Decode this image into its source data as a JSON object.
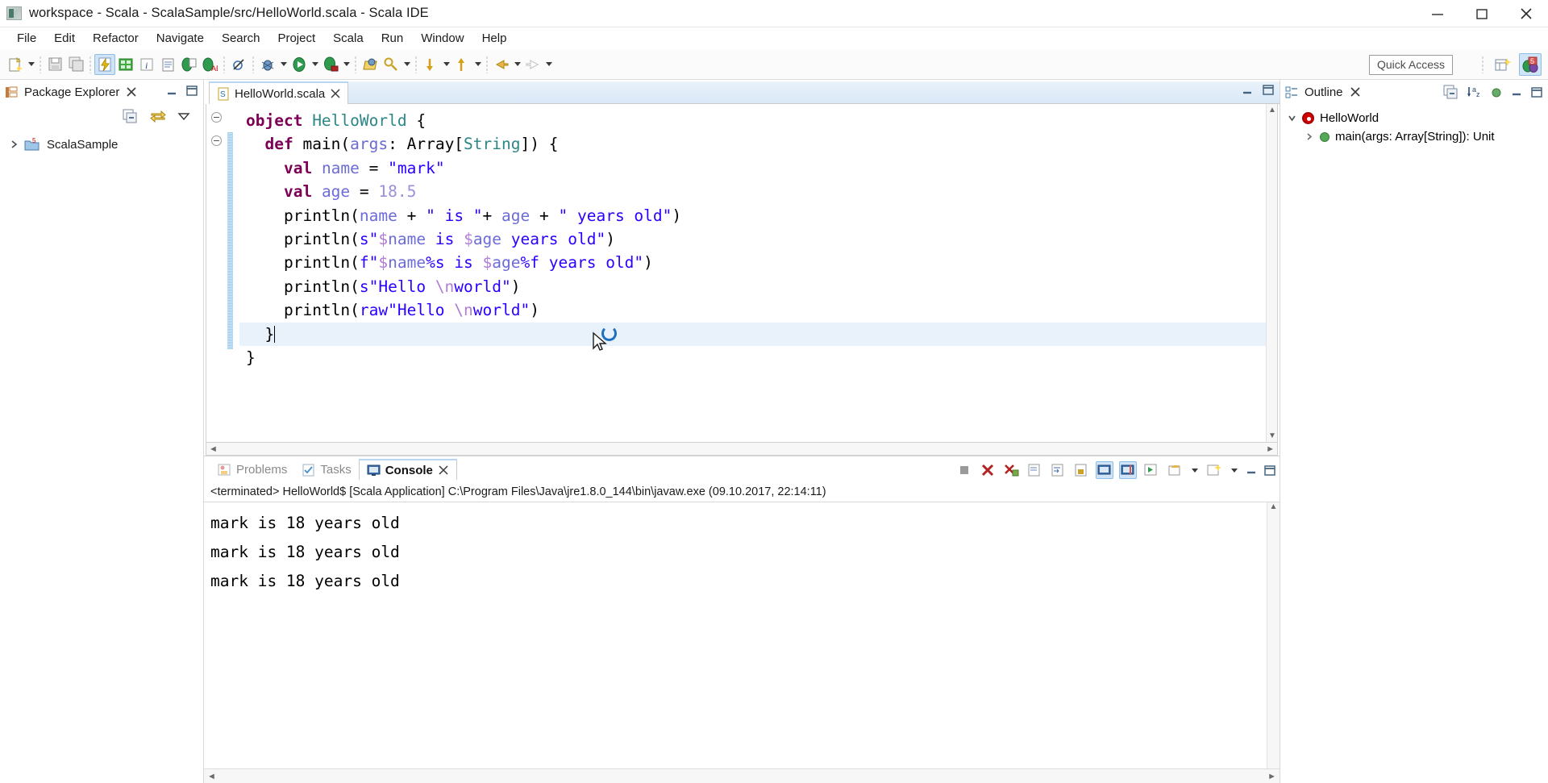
{
  "window": {
    "title": "workspace - Scala - ScalaSample/src/HelloWorld.scala - Scala IDE",
    "app_icon": "scala-ide-icon",
    "minimize_label": "minimize-icon",
    "maximize_label": "maximize-icon",
    "close_label": "close-icon"
  },
  "menubar": {
    "items": [
      {
        "label": "File"
      },
      {
        "label": "Edit"
      },
      {
        "label": "Refactor"
      },
      {
        "label": "Navigate"
      },
      {
        "label": "Search"
      },
      {
        "label": "Project"
      },
      {
        "label": "Scala"
      },
      {
        "label": "Run"
      },
      {
        "label": "Window"
      },
      {
        "label": "Help"
      }
    ]
  },
  "toolbar": {
    "quick_access_placeholder": "Quick Access",
    "items": [
      {
        "name": "new-wizard-icon",
        "has_dropdown": true
      },
      {
        "name": "save-icon",
        "has_dropdown": false
      },
      {
        "name": "save-all-icon",
        "has_dropdown": false
      },
      {
        "name": "build-icon",
        "has_dropdown": false,
        "selected": true
      },
      {
        "name": "toggle-breakpoint-icon",
        "has_dropdown": false
      },
      {
        "name": "italic-format-icon",
        "has_dropdown": false
      },
      {
        "name": "document-icon",
        "has_dropdown": false
      },
      {
        "name": "scala-interpreter-icon",
        "has_dropdown": false
      },
      {
        "name": "scala-worksheet-icon",
        "has_dropdown": false
      },
      {
        "name": "skip-breakpoints-icon",
        "has_dropdown": false
      },
      {
        "name": "debug-icon",
        "has_dropdown": true
      },
      {
        "name": "run-icon",
        "has_dropdown": true
      },
      {
        "name": "run-external-tools-icon",
        "has_dropdown": true
      },
      {
        "name": "open-type-icon",
        "has_dropdown": false
      },
      {
        "name": "search-icon",
        "has_dropdown": true
      },
      {
        "name": "next-annotation-icon",
        "has_dropdown": true
      },
      {
        "name": "previous-annotation-icon",
        "has_dropdown": true
      },
      {
        "name": "back-icon",
        "has_dropdown": true
      },
      {
        "name": "forward-icon",
        "has_dropdown": true
      }
    ],
    "right_items": [
      {
        "name": "open-perspective-icon"
      },
      {
        "name": "scala-perspective-icon",
        "active": true
      }
    ]
  },
  "package_explorer": {
    "title": "Package Explorer",
    "close_icon": "close-view-icon",
    "minimize_icon": "minimize-view-icon",
    "maximize_icon": "maximize-view-icon",
    "toolbar": [
      {
        "name": "collapse-all-icon"
      },
      {
        "name": "link-with-editor-icon"
      },
      {
        "name": "view-menu-icon"
      }
    ],
    "tree": [
      {
        "label": "ScalaSample",
        "icon": "scala-project-icon",
        "expanded": false
      }
    ]
  },
  "editor": {
    "tab": {
      "label": "HelloWorld.scala",
      "icon": "scala-file-icon",
      "close_icon": "close-tab-icon"
    },
    "tab_right_icons": [
      {
        "name": "minimize-editor-icon"
      },
      {
        "name": "maximize-editor-icon"
      }
    ],
    "scroll_left_icon": "scroll-left-arrow",
    "scroll_right_icon": "scroll-right-arrow",
    "code_lines": [
      {
        "indent": 0,
        "fold": true,
        "tokens": [
          {
            "t": "object ",
            "c": "kw"
          },
          {
            "t": "HelloWorld ",
            "c": "typ"
          },
          {
            "t": "{",
            "c": ""
          }
        ]
      },
      {
        "indent": 1,
        "fold": true,
        "tokens": [
          {
            "t": "def ",
            "c": "kw"
          },
          {
            "t": "main(",
            "c": ""
          },
          {
            "t": "args",
            "c": "var"
          },
          {
            "t": ": Array[",
            "c": ""
          },
          {
            "t": "String",
            "c": "typ"
          },
          {
            "t": "]) {",
            "c": ""
          }
        ]
      },
      {
        "indent": 2,
        "fold": false,
        "tokens": [
          {
            "t": "val ",
            "c": "kw"
          },
          {
            "t": "name",
            "c": "fld"
          },
          {
            "t": " = ",
            "c": ""
          },
          {
            "t": "\"mark\"",
            "c": "str"
          }
        ]
      },
      {
        "indent": 2,
        "fold": false,
        "tokens": [
          {
            "t": "val ",
            "c": "kw"
          },
          {
            "t": "age",
            "c": "fld"
          },
          {
            "t": " = ",
            "c": ""
          },
          {
            "t": "18.5",
            "c": "num"
          }
        ]
      },
      {
        "indent": 2,
        "fold": false,
        "tokens": [
          {
            "t": "println(",
            "c": ""
          },
          {
            "t": "name",
            "c": "fld"
          },
          {
            "t": " + ",
            "c": ""
          },
          {
            "t": "\" is \"",
            "c": "str"
          },
          {
            "t": "+ ",
            "c": ""
          },
          {
            "t": "age",
            "c": "fld"
          },
          {
            "t": " + ",
            "c": ""
          },
          {
            "t": "\" years old\"",
            "c": "str"
          },
          {
            "t": ")",
            "c": ""
          }
        ]
      },
      {
        "indent": 2,
        "fold": false,
        "tokens": [
          {
            "t": "println(",
            "c": ""
          },
          {
            "t": "s\"",
            "c": "str"
          },
          {
            "t": "$",
            "c": "esc"
          },
          {
            "t": "name",
            "c": "fld"
          },
          {
            "t": " is ",
            "c": "str"
          },
          {
            "t": "$",
            "c": "esc"
          },
          {
            "t": "age",
            "c": "fld"
          },
          {
            "t": " years old\"",
            "c": "str"
          },
          {
            "t": ")",
            "c": ""
          }
        ]
      },
      {
        "indent": 2,
        "fold": false,
        "tokens": [
          {
            "t": "println(",
            "c": ""
          },
          {
            "t": "f\"",
            "c": "str"
          },
          {
            "t": "$",
            "c": "esc"
          },
          {
            "t": "name",
            "c": "fld"
          },
          {
            "t": "%s is ",
            "c": "str"
          },
          {
            "t": "$",
            "c": "esc"
          },
          {
            "t": "age",
            "c": "fld"
          },
          {
            "t": "%f years old\"",
            "c": "str"
          },
          {
            "t": ")",
            "c": ""
          }
        ]
      },
      {
        "indent": 2,
        "fold": false,
        "tokens": [
          {
            "t": "println(",
            "c": ""
          },
          {
            "t": "s\"Hello ",
            "c": "str"
          },
          {
            "t": "\\n",
            "c": "esc"
          },
          {
            "t": "world\"",
            "c": "str"
          },
          {
            "t": ")",
            "c": ""
          }
        ]
      },
      {
        "indent": 2,
        "fold": false,
        "tokens": [
          {
            "t": "println(",
            "c": ""
          },
          {
            "t": "raw\"Hello ",
            "c": "str"
          },
          {
            "t": "\\n",
            "c": "esc"
          },
          {
            "t": "world\"",
            "c": "str"
          },
          {
            "t": ")",
            "c": ""
          }
        ]
      },
      {
        "indent": 1,
        "fold": false,
        "current": true,
        "cursor": true,
        "tokens": [
          {
            "t": "}",
            "c": ""
          }
        ]
      },
      {
        "indent": 0,
        "fold": false,
        "tokens": [
          {
            "t": "}",
            "c": ""
          }
        ]
      }
    ]
  },
  "console": {
    "tabs": [
      {
        "label": "Problems",
        "icon": "problems-icon",
        "active": false
      },
      {
        "label": "Tasks",
        "icon": "tasks-icon",
        "active": false
      },
      {
        "label": "Console",
        "icon": "console-icon",
        "active": true
      }
    ],
    "close_icon": "close-tab-icon",
    "toolbar": [
      {
        "name": "terminate-icon"
      },
      {
        "name": "remove-launch-icon"
      },
      {
        "name": "remove-all-terminated-icon"
      },
      {
        "name": "clear-console-icon"
      },
      {
        "name": "word-wrap-icon"
      },
      {
        "name": "scroll-lock-icon"
      },
      {
        "name": "show-console-on-output-icon",
        "on": true
      },
      {
        "name": "pin-console-icon",
        "on": true
      },
      {
        "name": "display-selected-console-icon"
      },
      {
        "name": "open-console-icon",
        "has_dropdown": true
      },
      {
        "name": "new-console-view-icon",
        "has_dropdown": true
      },
      {
        "name": "minimize-view-icon"
      },
      {
        "name": "maximize-view-icon"
      }
    ],
    "status_line": "<terminated> HelloWorld$ [Scala Application] C:\\Program Files\\Java\\jre1.8.0_144\\bin\\javaw.exe (09.10.2017, 22:14:11)",
    "output_lines": [
      "mark is 18 years old",
      "mark is 18 years old",
      "mark is 18 years old"
    ]
  },
  "outline": {
    "title": "Outline",
    "close_icon": "close-view-icon",
    "toolbar": [
      {
        "name": "collapse-all-icon"
      },
      {
        "name": "sort-alphabetically-icon"
      },
      {
        "name": "hide-non-public-members-icon"
      },
      {
        "name": "minimize-view-icon"
      },
      {
        "name": "maximize-view-icon"
      }
    ],
    "tree": [
      {
        "label": "HelloWorld",
        "icon": "scala-object-icon",
        "level": 1,
        "expanded": true
      },
      {
        "label": "main(args: Array[String]): Unit",
        "icon": "method-icon",
        "level": 2,
        "expanded": false
      }
    ]
  },
  "colors": {
    "accent_blue": "#cfe4f7",
    "keyword": "#7c0055",
    "type": "#2b8686",
    "string": "#2a00ff",
    "number": "#9a8fd8",
    "field": "#6c6cd8",
    "escape": "#b07cd8",
    "current_line": "#e9f1fb"
  }
}
